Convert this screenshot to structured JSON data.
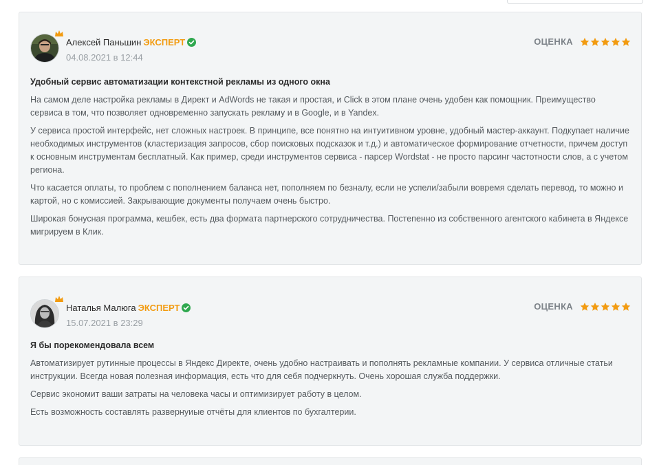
{
  "reviews": [
    {
      "author": "Алексей Паньшин",
      "badge": "ЭКСПЕРТ",
      "date": "04.08.2021 в 12:44",
      "rating_label": "ОЦЕНКА",
      "rating": 5,
      "title": "Удобный сервис автоматизации контекстной рекламы из одного окна",
      "paragraphs": [
        "На самом деле настройка рекламы в Директ и AdWords не такая и простая, и Click в этом плане очень удобен как помощник. Преимущество сервиса в том, что позволяет одновременно запускать рекламу и в Google, и в Yandex.",
        "У сервиса простой интерфейс, нет сложных настроек. В принципе, все понятно на интуитивном уровне, удобный мастер-аккаунт. Подкупает наличие необходимых инструментов (кластеризация запросов, сбор поисковых подсказок и т.д.) и автоматическое формирование отчетности, причем доступ к основным инструментам бесплатный. Как пример, среди инструментов сервиса - парсер Wordstat - не просто парсинг частотности слов, а с учетом региона.",
        "Что касается оплаты, то проблем с пополнением баланса нет, пополняем по безналу, если не успели/забыли вовремя сделать перевод, то можно и картой, но с комиссией. Закрывающие документы получаем очень быстро.",
        "Широкая бонусная программа, кешбек, есть два формата партнерского сотрудничества. Постепенно из собственного агентского кабинета в Яндексе мигрируем в Клик."
      ]
    },
    {
      "author": "Наталья Малюга",
      "badge": "ЭКСПЕРТ",
      "date": "15.07.2021 в 23:29",
      "rating_label": "ОЦЕНКА",
      "rating": 5,
      "title": "Я бы порекомендовала всем",
      "paragraphs": [
        "Автоматизирует рутинные процессы в Яндекс Директе, очень удобно настраивать и пополнять рекламные компании. У сервиса отличные статьи инструкции. Всегда новая полезная информация, есть что для себя подчеркнуть. Очень хорошая служба поддержки.",
        "Сервис экономит ваши затраты на человека часы и оптимизирует работу в целом.",
        "Есть возможность составлять развернуиые отчёты для клиентов по бухгалтерии."
      ]
    }
  ],
  "colors": {
    "expert": "#f29b11",
    "star": "#f29b11",
    "verified": "#2fa84f",
    "card_bg": "#f3f5f6"
  },
  "icons": {
    "verified": "check-circle-icon",
    "crown": "crown-icon",
    "star": "star-icon"
  }
}
